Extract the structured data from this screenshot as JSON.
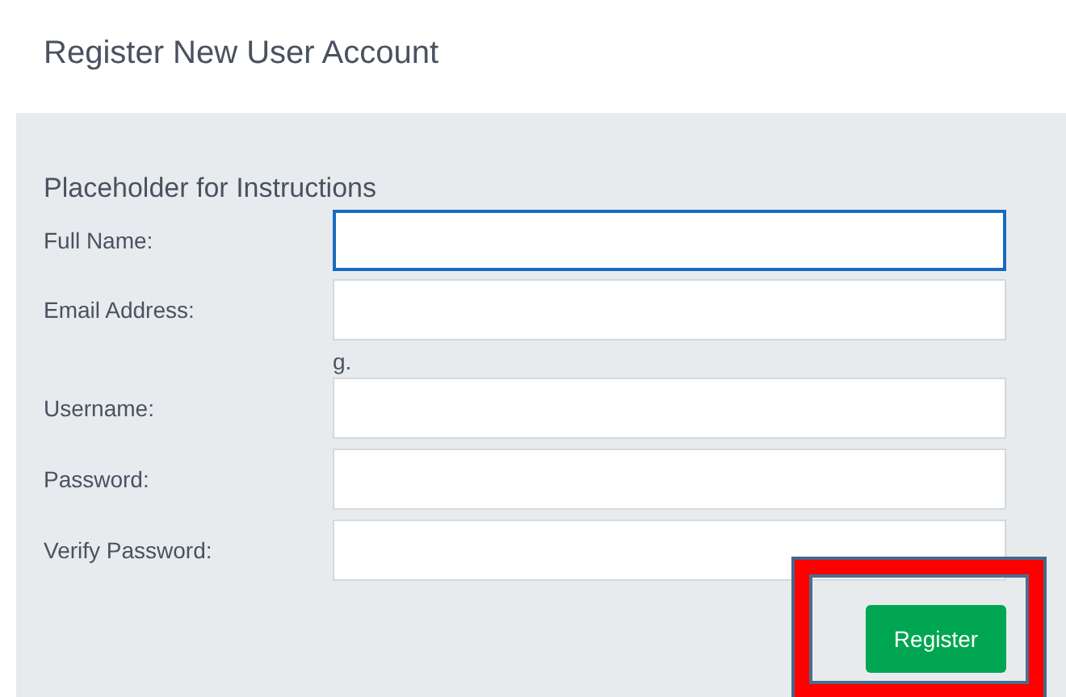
{
  "title": "Register New User Account",
  "instructions": "Placeholder for Instructions",
  "fields": [
    {
      "label": "Full Name:",
      "focused": true
    },
    {
      "label": "Email Address:",
      "focused": false
    },
    {
      "label": "Username:",
      "focused": false,
      "note_above": "g."
    },
    {
      "label": "Password:",
      "focused": false
    },
    {
      "label": "Verify Password:",
      "focused": false
    }
  ],
  "button": {
    "label": "Register",
    "highlighted": true
  }
}
